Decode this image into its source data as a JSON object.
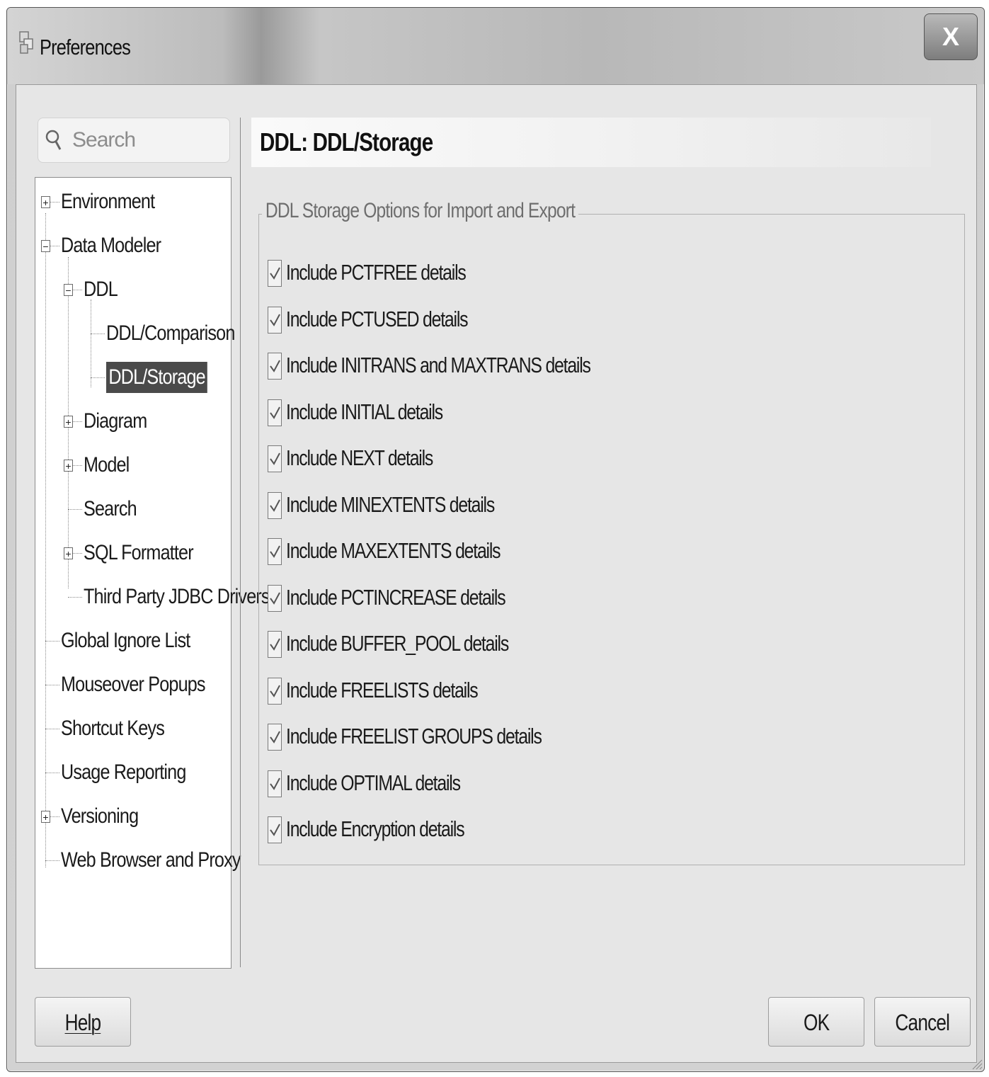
{
  "window": {
    "title": "Preferences",
    "close_label": "X"
  },
  "search": {
    "placeholder": "Search"
  },
  "tree": {
    "items": [
      {
        "label": "Environment",
        "expander": "+"
      },
      {
        "label": "Data Modeler",
        "expander": "-"
      },
      {
        "label": "DDL",
        "expander": "-"
      },
      {
        "label": "DDL/Comparison"
      },
      {
        "label": "DDL/Storage",
        "selected": true
      },
      {
        "label": "Diagram",
        "expander": "+"
      },
      {
        "label": "Model",
        "expander": "+"
      },
      {
        "label": "Search"
      },
      {
        "label": "SQL Formatter",
        "expander": "+"
      },
      {
        "label": "Third Party JDBC Drivers"
      },
      {
        "label": "Global Ignore List"
      },
      {
        "label": "Mouseover Popups"
      },
      {
        "label": "Shortcut Keys"
      },
      {
        "label": "Usage Reporting"
      },
      {
        "label": "Versioning",
        "expander": "+"
      },
      {
        "label": "Web Browser and Proxy"
      }
    ]
  },
  "page": {
    "title": "DDL: DDL/Storage",
    "group_title": "DDL Storage Options for Import and Export",
    "options": [
      {
        "label": "Include PCTFREE details",
        "checked": true
      },
      {
        "label": "Include PCTUSED details",
        "checked": true
      },
      {
        "label": "Include INITRANS and MAXTRANS details",
        "checked": true
      },
      {
        "label": "Include INITIAL details",
        "checked": true
      },
      {
        "label": "Include NEXT details",
        "checked": true
      },
      {
        "label": "Include MINEXTENTS details",
        "checked": true
      },
      {
        "label": "Include MAXEXTENTS details",
        "checked": true
      },
      {
        "label": "Include PCTINCREASE details",
        "checked": true
      },
      {
        "label": "Include BUFFER_POOL details",
        "checked": true
      },
      {
        "label": "Include FREELISTS details",
        "checked": true
      },
      {
        "label": "Include FREELIST GROUPS details",
        "checked": true
      },
      {
        "label": "Include OPTIMAL details",
        "checked": true
      },
      {
        "label": "Include Encryption details",
        "checked": true
      }
    ]
  },
  "buttons": {
    "help": "Help",
    "ok": "OK",
    "cancel": "Cancel"
  }
}
